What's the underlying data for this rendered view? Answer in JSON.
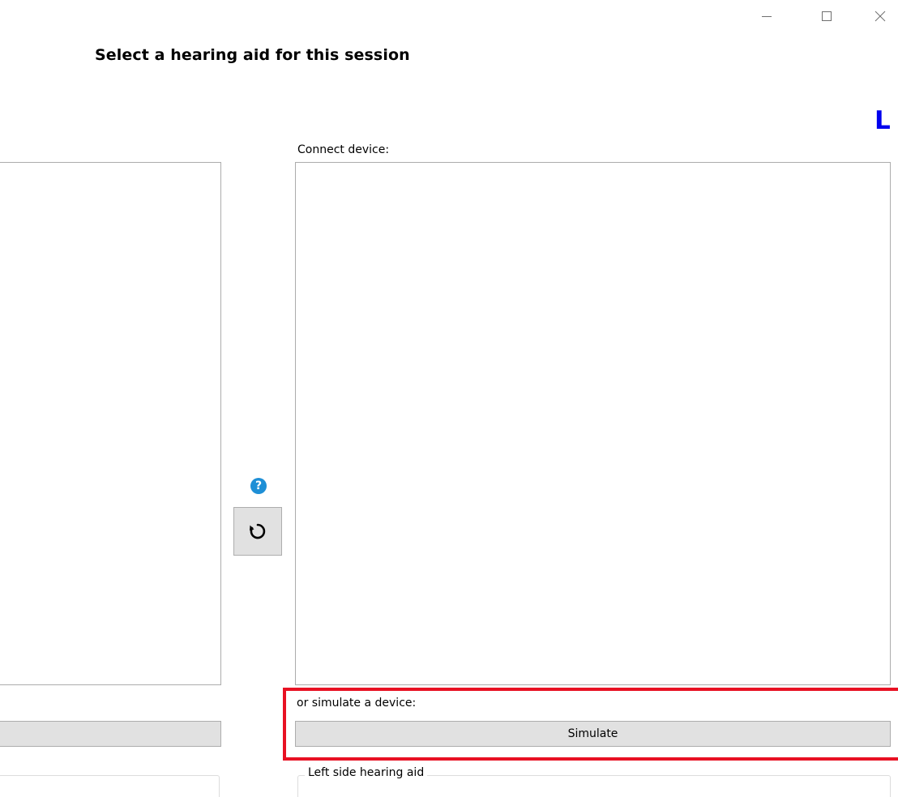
{
  "window": {
    "controls": {
      "minimize_icon": "minimize-icon",
      "maximize_icon": "maximize-icon",
      "close_icon": "close-icon"
    }
  },
  "header": {
    "title": "Select a hearing aid for this session",
    "side_indicator": "L",
    "side_indicator_color": "#0000ee"
  },
  "left_panel": {
    "button_label": "",
    "group_title": ""
  },
  "middle": {
    "help_icon_glyph": "?",
    "help_icon_color": "#1e8fd6",
    "refresh_icon": "refresh-icon"
  },
  "right_panel": {
    "connect_label": "Connect device:",
    "device_list": [],
    "simulate_label": "or simulate a device:",
    "simulate_button": "Simulate",
    "group_title": "Left side hearing aid",
    "highlight_color": "#e81123"
  }
}
